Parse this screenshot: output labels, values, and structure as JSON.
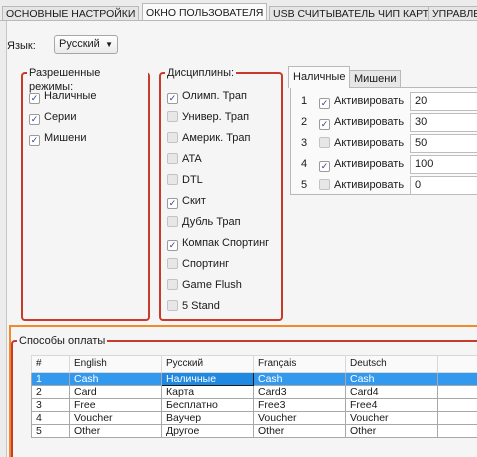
{
  "tabs": [
    {
      "label": "ОСНОВНЫЕ НАСТРОЙКИ",
      "active": false
    },
    {
      "label": "ОКНО ПОЛЬЗОВАТЕЛЯ",
      "active": true
    },
    {
      "label": "USB СЧИТЫВАТЕЛЬ ЧИП КАРТ",
      "active": false
    },
    {
      "label": "УПРАВЛЕ",
      "active": false
    }
  ],
  "language": {
    "label": "Язык:",
    "selected": "Русский"
  },
  "modes": {
    "legend": "Разрешенные режимы:",
    "items": [
      {
        "label": "Наличные",
        "checked": true
      },
      {
        "label": "Серии",
        "checked": true
      },
      {
        "label": "Мишени",
        "checked": true
      }
    ]
  },
  "disciplines": {
    "legend": "Дисциплины:",
    "items": [
      {
        "label": "Олимп. Трап",
        "checked": true
      },
      {
        "label": "Универ. Трап",
        "checked": false
      },
      {
        "label": "Америк. Трап",
        "checked": false
      },
      {
        "label": "ATA",
        "checked": false
      },
      {
        "label": "DTL",
        "checked": false
      },
      {
        "label": "Скит",
        "checked": true
      },
      {
        "label": "Дубль Трап",
        "checked": false
      },
      {
        "label": "Компак Спортинг",
        "checked": true
      },
      {
        "label": "Спортинг",
        "checked": false
      },
      {
        "label": "Game Flush",
        "checked": false
      },
      {
        "label": "5 Stand",
        "checked": false
      }
    ]
  },
  "inner_tabs": [
    {
      "label": "Наличные",
      "active": true
    },
    {
      "label": "Мишени",
      "active": false
    }
  ],
  "cash_rows": [
    {
      "num": "1",
      "checked": true,
      "label": "Активировать",
      "value": "20"
    },
    {
      "num": "2",
      "checked": true,
      "label": "Активировать",
      "value": "30"
    },
    {
      "num": "3",
      "checked": false,
      "label": "Активировать",
      "value": "50"
    },
    {
      "num": "4",
      "checked": true,
      "label": "Активировать",
      "value": "100"
    },
    {
      "num": "5",
      "checked": false,
      "label": "Активировать",
      "value": "0"
    }
  ],
  "payment": {
    "legend": "Способы оплаты",
    "columns": [
      "#",
      "English",
      "Русский",
      "Français",
      "Deutsch"
    ],
    "rows": [
      [
        "1",
        "Cash",
        "Наличные",
        "Cash",
        "Cash"
      ],
      [
        "2",
        "Card",
        "Карта",
        "Card3",
        "Card4"
      ],
      [
        "3",
        "Free",
        "Бесплатно",
        "Free3",
        "Free4"
      ],
      [
        "4",
        "Voucher",
        "Ваучер",
        "Voucher",
        "Voucher"
      ],
      [
        "5",
        "Other",
        "Другое",
        "Other",
        "Other"
      ]
    ],
    "selected_row": 0
  },
  "colors": {
    "accent_red": "#c83a2a",
    "accent_orange": "#f08a2d",
    "selection": "#3399ee"
  }
}
